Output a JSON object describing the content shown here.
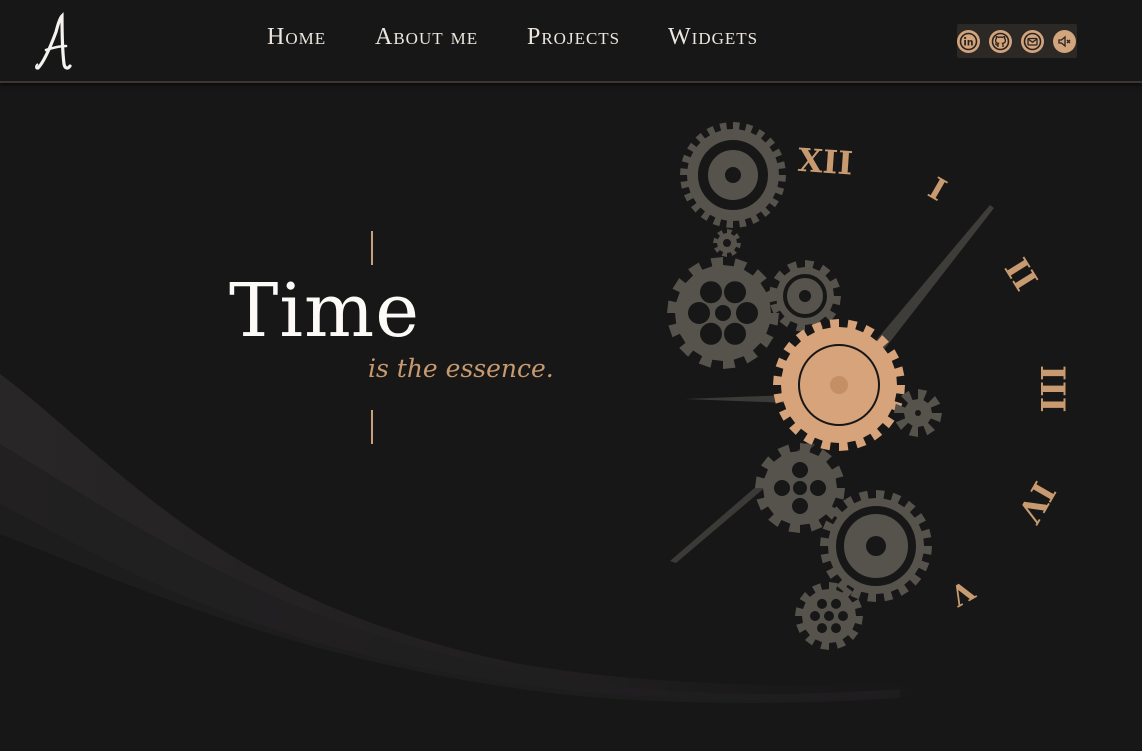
{
  "brand": {
    "logo_letter": "A"
  },
  "nav": {
    "items": [
      {
        "label": "Home"
      },
      {
        "label": "About me"
      },
      {
        "label": "Projects"
      },
      {
        "label": "Widgets"
      }
    ]
  },
  "socials": [
    {
      "icon": "linkedin-icon"
    },
    {
      "icon": "github-icon"
    },
    {
      "icon": "mail-icon"
    },
    {
      "icon": "sound-muted-icon"
    }
  ],
  "hero": {
    "title": "Time",
    "subtitle": "is the essence."
  },
  "clock": {
    "numerals": [
      "XII",
      "I",
      "II",
      "III",
      "IV",
      "V"
    ]
  },
  "colors": {
    "background": "#181718",
    "accent": "#c9a07a",
    "gear": "#55534b",
    "text": "#fbfaf7"
  }
}
